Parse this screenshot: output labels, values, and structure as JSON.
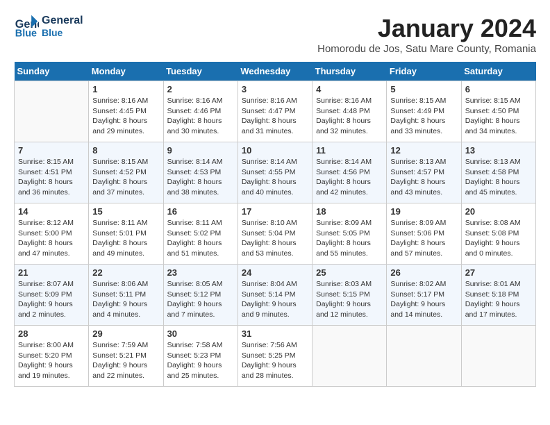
{
  "header": {
    "logo_line1": "General",
    "logo_line2": "Blue",
    "title": "January 2024",
    "subtitle": "Homorodu de Jos, Satu Mare County, Romania"
  },
  "weekdays": [
    "Sunday",
    "Monday",
    "Tuesday",
    "Wednesday",
    "Thursday",
    "Friday",
    "Saturday"
  ],
  "weeks": [
    [
      {
        "day": "",
        "empty": true
      },
      {
        "day": "1",
        "sunrise": "Sunrise: 8:16 AM",
        "sunset": "Sunset: 4:45 PM",
        "daylight": "Daylight: 8 hours and 29 minutes."
      },
      {
        "day": "2",
        "sunrise": "Sunrise: 8:16 AM",
        "sunset": "Sunset: 4:46 PM",
        "daylight": "Daylight: 8 hours and 30 minutes."
      },
      {
        "day": "3",
        "sunrise": "Sunrise: 8:16 AM",
        "sunset": "Sunset: 4:47 PM",
        "daylight": "Daylight: 8 hours and 31 minutes."
      },
      {
        "day": "4",
        "sunrise": "Sunrise: 8:16 AM",
        "sunset": "Sunset: 4:48 PM",
        "daylight": "Daylight: 8 hours and 32 minutes."
      },
      {
        "day": "5",
        "sunrise": "Sunrise: 8:15 AM",
        "sunset": "Sunset: 4:49 PM",
        "daylight": "Daylight: 8 hours and 33 minutes."
      },
      {
        "day": "6",
        "sunrise": "Sunrise: 8:15 AM",
        "sunset": "Sunset: 4:50 PM",
        "daylight": "Daylight: 8 hours and 34 minutes."
      }
    ],
    [
      {
        "day": "7",
        "sunrise": "Sunrise: 8:15 AM",
        "sunset": "Sunset: 4:51 PM",
        "daylight": "Daylight: 8 hours and 36 minutes."
      },
      {
        "day": "8",
        "sunrise": "Sunrise: 8:15 AM",
        "sunset": "Sunset: 4:52 PM",
        "daylight": "Daylight: 8 hours and 37 minutes."
      },
      {
        "day": "9",
        "sunrise": "Sunrise: 8:14 AM",
        "sunset": "Sunset: 4:53 PM",
        "daylight": "Daylight: 8 hours and 38 minutes."
      },
      {
        "day": "10",
        "sunrise": "Sunrise: 8:14 AM",
        "sunset": "Sunset: 4:55 PM",
        "daylight": "Daylight: 8 hours and 40 minutes."
      },
      {
        "day": "11",
        "sunrise": "Sunrise: 8:14 AM",
        "sunset": "Sunset: 4:56 PM",
        "daylight": "Daylight: 8 hours and 42 minutes."
      },
      {
        "day": "12",
        "sunrise": "Sunrise: 8:13 AM",
        "sunset": "Sunset: 4:57 PM",
        "daylight": "Daylight: 8 hours and 43 minutes."
      },
      {
        "day": "13",
        "sunrise": "Sunrise: 8:13 AM",
        "sunset": "Sunset: 4:58 PM",
        "daylight": "Daylight: 8 hours and 45 minutes."
      }
    ],
    [
      {
        "day": "14",
        "sunrise": "Sunrise: 8:12 AM",
        "sunset": "Sunset: 5:00 PM",
        "daylight": "Daylight: 8 hours and 47 minutes."
      },
      {
        "day": "15",
        "sunrise": "Sunrise: 8:11 AM",
        "sunset": "Sunset: 5:01 PM",
        "daylight": "Daylight: 8 hours and 49 minutes."
      },
      {
        "day": "16",
        "sunrise": "Sunrise: 8:11 AM",
        "sunset": "Sunset: 5:02 PM",
        "daylight": "Daylight: 8 hours and 51 minutes."
      },
      {
        "day": "17",
        "sunrise": "Sunrise: 8:10 AM",
        "sunset": "Sunset: 5:04 PM",
        "daylight": "Daylight: 8 hours and 53 minutes."
      },
      {
        "day": "18",
        "sunrise": "Sunrise: 8:09 AM",
        "sunset": "Sunset: 5:05 PM",
        "daylight": "Daylight: 8 hours and 55 minutes."
      },
      {
        "day": "19",
        "sunrise": "Sunrise: 8:09 AM",
        "sunset": "Sunset: 5:06 PM",
        "daylight": "Daylight: 8 hours and 57 minutes."
      },
      {
        "day": "20",
        "sunrise": "Sunrise: 8:08 AM",
        "sunset": "Sunset: 5:08 PM",
        "daylight": "Daylight: 9 hours and 0 minutes."
      }
    ],
    [
      {
        "day": "21",
        "sunrise": "Sunrise: 8:07 AM",
        "sunset": "Sunset: 5:09 PM",
        "daylight": "Daylight: 9 hours and 2 minutes."
      },
      {
        "day": "22",
        "sunrise": "Sunrise: 8:06 AM",
        "sunset": "Sunset: 5:11 PM",
        "daylight": "Daylight: 9 hours and 4 minutes."
      },
      {
        "day": "23",
        "sunrise": "Sunrise: 8:05 AM",
        "sunset": "Sunset: 5:12 PM",
        "daylight": "Daylight: 9 hours and 7 minutes."
      },
      {
        "day": "24",
        "sunrise": "Sunrise: 8:04 AM",
        "sunset": "Sunset: 5:14 PM",
        "daylight": "Daylight: 9 hours and 9 minutes."
      },
      {
        "day": "25",
        "sunrise": "Sunrise: 8:03 AM",
        "sunset": "Sunset: 5:15 PM",
        "daylight": "Daylight: 9 hours and 12 minutes."
      },
      {
        "day": "26",
        "sunrise": "Sunrise: 8:02 AM",
        "sunset": "Sunset: 5:17 PM",
        "daylight": "Daylight: 9 hours and 14 minutes."
      },
      {
        "day": "27",
        "sunrise": "Sunrise: 8:01 AM",
        "sunset": "Sunset: 5:18 PM",
        "daylight": "Daylight: 9 hours and 17 minutes."
      }
    ],
    [
      {
        "day": "28",
        "sunrise": "Sunrise: 8:00 AM",
        "sunset": "Sunset: 5:20 PM",
        "daylight": "Daylight: 9 hours and 19 minutes."
      },
      {
        "day": "29",
        "sunrise": "Sunrise: 7:59 AM",
        "sunset": "Sunset: 5:21 PM",
        "daylight": "Daylight: 9 hours and 22 minutes."
      },
      {
        "day": "30",
        "sunrise": "Sunrise: 7:58 AM",
        "sunset": "Sunset: 5:23 PM",
        "daylight": "Daylight: 9 hours and 25 minutes."
      },
      {
        "day": "31",
        "sunrise": "Sunrise: 7:56 AM",
        "sunset": "Sunset: 5:25 PM",
        "daylight": "Daylight: 9 hours and 28 minutes."
      },
      {
        "day": "",
        "empty": true
      },
      {
        "day": "",
        "empty": true
      },
      {
        "day": "",
        "empty": true
      }
    ]
  ]
}
